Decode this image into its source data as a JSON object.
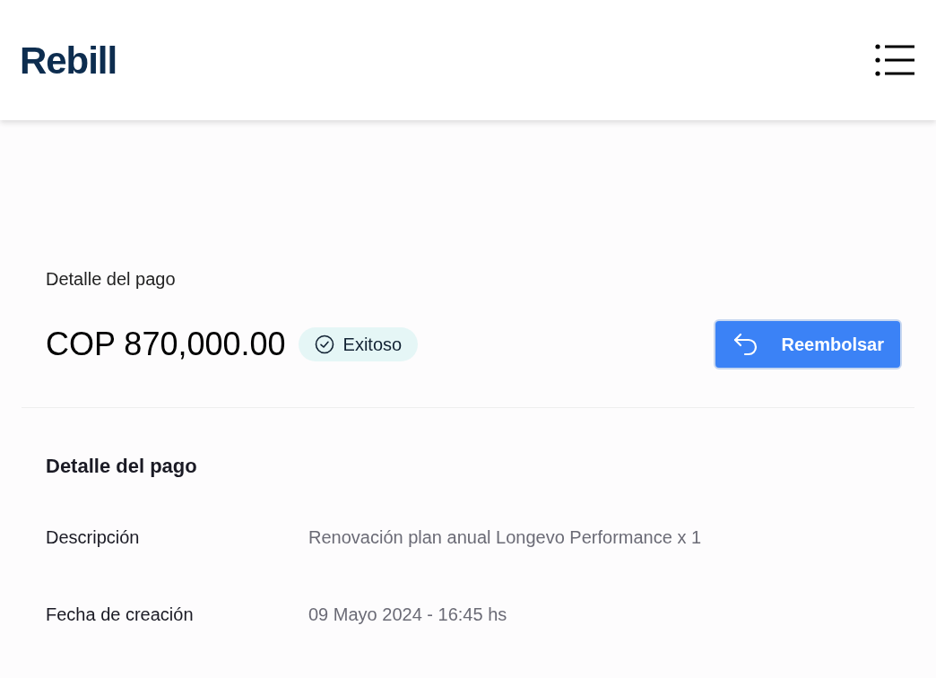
{
  "header": {
    "logo": "Rebill"
  },
  "summary": {
    "label": "Detalle del pago",
    "amount": "COP 870,000.00",
    "status": {
      "text": "Exitoso",
      "kind": "success"
    },
    "refund_button": "Reembolsar"
  },
  "details": {
    "title": "Detalle del pago",
    "rows": [
      {
        "label": "Descripción",
        "value": "Renovación plan anual Longevo Performance x 1"
      },
      {
        "label": "Fecha de creación",
        "value": "09 Mayo 2024 - 16:45 hs"
      }
    ]
  }
}
